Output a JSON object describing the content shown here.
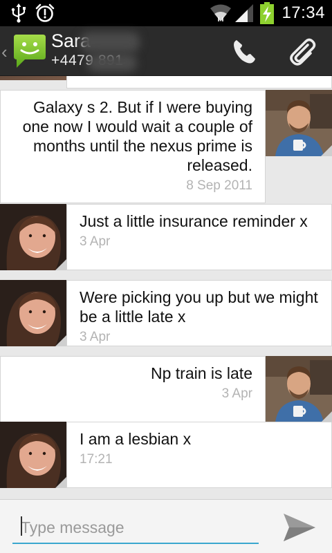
{
  "status_bar": {
    "time": "17:34",
    "icons": [
      "usb-icon",
      "alarm-icon",
      "wifi-icon",
      "signal-icon",
      "battery-charging-icon"
    ]
  },
  "header": {
    "contact_name": "Sara",
    "contact_number": "+4479          891",
    "icons": [
      "messaging-app-icon",
      "phone-icon",
      "attach-icon"
    ]
  },
  "messages": [
    {
      "direction": "out",
      "text": "Galaxy s 2. But if I were buying one now I would wait a couple of months until the nexus prime is released.",
      "date": "8 Sep 2011"
    },
    {
      "direction": "in",
      "text": "Just a little insurance reminder x",
      "date": "3 Apr"
    },
    {
      "direction": "in",
      "text": "Were picking you up but we might be a little late x",
      "date": "3 Apr"
    },
    {
      "direction": "out",
      "text": "Np train is late",
      "date": "3 Apr"
    },
    {
      "direction": "in",
      "text": "I am a lesbian x",
      "date": "17:21"
    }
  ],
  "composer": {
    "placeholder": "Type message",
    "value": "",
    "send_icon": "send-icon"
  },
  "colors": {
    "status_bar_bg": "#000000",
    "action_bar_bg": "#2b2b2b",
    "app_icon_green": "#7dc42c",
    "battery_green": "#8ed12f",
    "input_underline": "#3aa7cf",
    "date_text": "#b3b3b3"
  }
}
